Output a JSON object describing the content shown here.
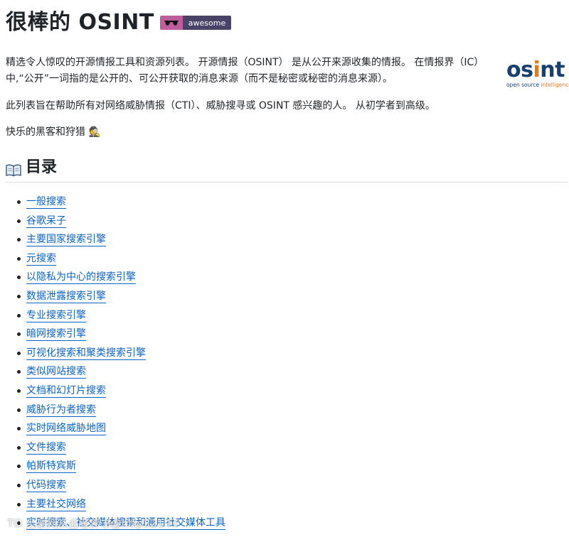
{
  "header": {
    "title": "很棒的 OSINT",
    "badge_label": "awesome",
    "badge_icon": "sunglasses-icon"
  },
  "intro": {
    "paragraph1": "精选令人惊叹的开源情报工具和资源列表。 开源情报（OSINT） 是从公开来源收集的情报。 在情报界（IC）中,“公开”一词指的是公开的、可公开获取的消息来源（而不是秘密或秘密的消息来源）。",
    "paragraph2": "此列表旨在帮助所有对网络威胁情报（CTI）、威胁搜寻或 OSINT 感兴趣的人。 从初学者到高级。",
    "paragraph3": "快乐的黑客和狩猎 🕵️"
  },
  "logo": {
    "word": "osint",
    "sub_left": "open source ",
    "sub_right": "intelligence"
  },
  "toc": {
    "heading": "目录",
    "icon": "open-book-icon",
    "items": [
      "一般搜索",
      "谷歌呆子",
      "主要国家搜索引擎",
      "元搜索",
      "以隐私为中心的搜索引擎",
      "数据泄露搜索引擎",
      "专业搜索引擎",
      "暗网搜索引擎",
      "可视化搜索和聚类搜索引擎",
      "类似网站搜索",
      "文档和幻灯片搜索",
      "威胁行为者搜索",
      "实时网络威胁地图",
      "文件搜索",
      "帕斯特宾斯",
      "代码搜索",
      "主要社交网络",
      "实时搜索、社交媒体搜索和通用社交媒体工具"
    ]
  },
  "watermark": "TO 土豪网从业者养书@http321 FF",
  "colors": {
    "link": "#0b63c5",
    "badge_left": "#bf5e9c",
    "badge_right": "#494368",
    "logo_blue": "#18406e",
    "logo_orange": "#e07b1f"
  }
}
